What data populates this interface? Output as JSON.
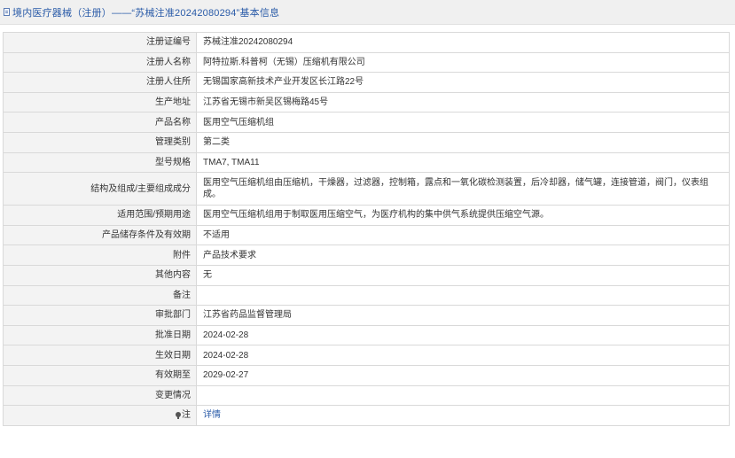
{
  "header": {
    "title": "境内医疗器械（注册）——“苏械注准20242080294”基本信息",
    "icon": "document-icon"
  },
  "rows": [
    {
      "label": "注册证编号",
      "value": "苏械注准20242080294"
    },
    {
      "label": "注册人名称",
      "value": "阿特拉斯.科普柯（无锡）压缩机有限公司"
    },
    {
      "label": "注册人住所",
      "value": "无锡国家高新技术产业开发区长江路22号"
    },
    {
      "label": "生产地址",
      "value": "江苏省无锡市新吴区锡梅路45号"
    },
    {
      "label": "产品名称",
      "value": "医用空气压缩机组"
    },
    {
      "label": "管理类别",
      "value": "第二类"
    },
    {
      "label": "型号规格",
      "value": "TMA7, TMA11"
    },
    {
      "label": "结构及组成/主要组成成分",
      "value": "医用空气压缩机组由压缩机，干燥器，过滤器，控制箱，露点和一氧化碳检测装置，后冷却器，储气罐，连接管道，阀门，仪表组成。"
    },
    {
      "label": "适用范围/预期用途",
      "value": "医用空气压缩机组用于制取医用压缩空气，为医疗机构的集中供气系统提供压缩空气源。"
    },
    {
      "label": "产品储存条件及有效期",
      "value": "不适用"
    },
    {
      "label": "附件",
      "value": "产品技术要求"
    },
    {
      "label": "其他内容",
      "value": "无"
    },
    {
      "label": "备注",
      "value": ""
    },
    {
      "label": "审批部门",
      "value": "江苏省药品监督管理局"
    },
    {
      "label": "批准日期",
      "value": "2024-02-28"
    },
    {
      "label": "生效日期",
      "value": "2024-02-28"
    },
    {
      "label": "有效期至",
      "value": "2029-02-27"
    },
    {
      "label": "变更情况",
      "value": ""
    }
  ],
  "note": {
    "label": "注",
    "icon": "pin-icon",
    "link_text": "详情"
  },
  "colors": {
    "link": "#2a5ba8",
    "label_bg": "#f3f3f3",
    "border": "#d9d9d9",
    "header_bg": "#f0f0f0"
  }
}
